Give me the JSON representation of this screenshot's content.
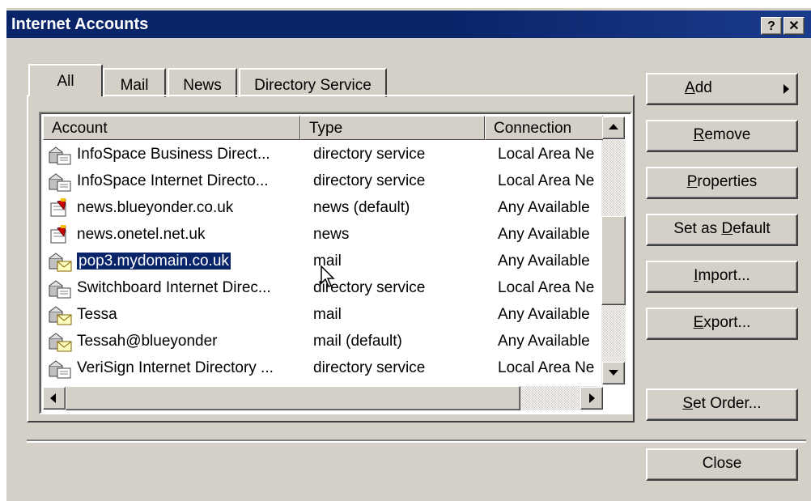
{
  "window": {
    "title": "Internet Accounts",
    "help_label": "?",
    "close_label": "✕"
  },
  "tabs": [
    {
      "label": "All",
      "active": true
    },
    {
      "label": "Mail",
      "active": false
    },
    {
      "label": "News",
      "active": false
    },
    {
      "label": "Directory Service",
      "active": false
    }
  ],
  "list": {
    "columns": [
      "Account",
      "Type",
      "Connection"
    ],
    "rows": [
      {
        "account": "InfoSpace Business Direct...",
        "type": "directory service",
        "connection": "Local Area Ne",
        "icon": "directory-service-icon",
        "selected": false
      },
      {
        "account": "InfoSpace Internet Directo...",
        "type": "directory service",
        "connection": "Local Area Ne",
        "icon": "directory-service-icon",
        "selected": false
      },
      {
        "account": "news.blueyonder.co.uk",
        "type": "news (default)",
        "connection": "Any Available",
        "icon": "news-icon",
        "selected": false
      },
      {
        "account": "news.onetel.net.uk",
        "type": "news",
        "connection": "Any Available",
        "icon": "news-icon",
        "selected": false
      },
      {
        "account": "pop3.mydomain.co.uk",
        "type": "mail",
        "connection": "Any Available",
        "icon": "mail-account-icon",
        "selected": true
      },
      {
        "account": "Switchboard Internet Direc...",
        "type": "directory service",
        "connection": "Local Area Ne",
        "icon": "directory-service-icon",
        "selected": false
      },
      {
        "account": "Tessa",
        "type": "mail",
        "connection": "Any Available",
        "icon": "mail-account-icon",
        "selected": false
      },
      {
        "account": "Tessah@blueyonder",
        "type": "mail (default)",
        "connection": "Any Available",
        "icon": "mail-account-icon",
        "selected": false
      },
      {
        "account": "VeriSign Internet Directory ...",
        "type": "directory service",
        "connection": "Local Area Ne",
        "icon": "directory-service-icon",
        "selected": false
      }
    ]
  },
  "buttons": {
    "add": {
      "label": "Add",
      "accel": "A",
      "rest": "dd"
    },
    "remove": {
      "label": "Remove",
      "accel": "R",
      "rest": "emove"
    },
    "properties": {
      "label": "Properties",
      "accel": "P",
      "rest": "roperties"
    },
    "set_default": {
      "label": "Set as Default",
      "pre": "Set as ",
      "accel": "D",
      "rest": "efault"
    },
    "import": {
      "label": "Import...",
      "accel": "I",
      "rest": "mport..."
    },
    "export": {
      "label": "Export...",
      "accel": "E",
      "rest": "xport..."
    },
    "set_order": {
      "label": "Set Order...",
      "accel": "S",
      "rest": "et Order..."
    },
    "close": {
      "label": "Close"
    }
  },
  "colors": {
    "titlebar": "#0a246a",
    "face": "#d4d0c8",
    "selection": "#0a246a"
  }
}
